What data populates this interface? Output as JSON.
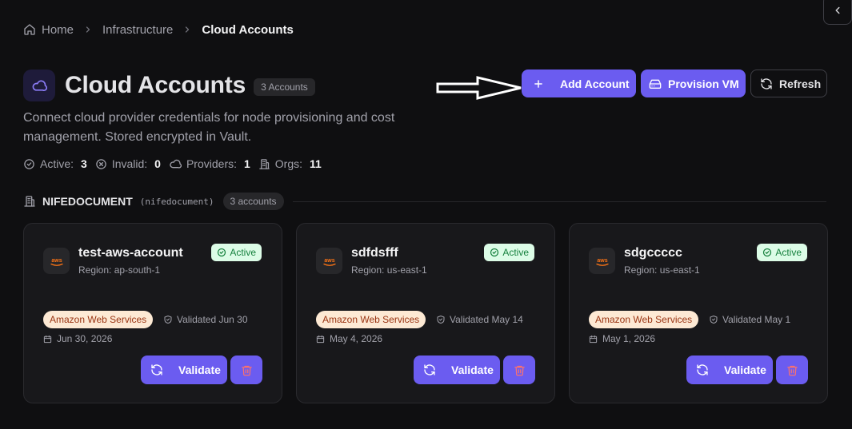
{
  "breadcrumb": {
    "items": [
      "Home",
      "Infrastructure",
      "Cloud Accounts"
    ]
  },
  "header": {
    "title": "Cloud Accounts",
    "count_label": "3 Accounts",
    "description": "Connect cloud provider credentials for node provisioning and cost management. Stored encrypted in Vault."
  },
  "actions": {
    "add_label": "Add Account",
    "provision_label": "Provision VM",
    "refresh_label": "Refresh"
  },
  "stats": {
    "active_label": "Active:",
    "active_value": "3",
    "invalid_label": "Invalid:",
    "invalid_value": "0",
    "providers_label": "Providers:",
    "providers_value": "1",
    "orgs_label": "Orgs:",
    "orgs_value": "11"
  },
  "org": {
    "name": "NIFEDOCUMENT",
    "slug": "(nifedocument)",
    "count_label": "3 accounts"
  },
  "accounts": [
    {
      "name": "test-aws-account",
      "region": "Region: ap-south-1",
      "status": "Active",
      "provider": "Amazon Web Services",
      "validated": "Validated Jun 30",
      "date": "Jun 30, 2026",
      "validate_label": "Validate"
    },
    {
      "name": "sdfdsfff",
      "region": "Region: us-east-1",
      "status": "Active",
      "provider": "Amazon Web Services",
      "validated": "Validated May 14",
      "date": "May 4, 2026",
      "validate_label": "Validate"
    },
    {
      "name": "sdgccccc",
      "region": "Region: us-east-1",
      "status": "Active",
      "provider": "Amazon Web Services",
      "validated": "Validated May 1",
      "date": "May 1, 2026",
      "validate_label": "Validate"
    }
  ],
  "colors": {
    "accent": "#6b5cf0",
    "background": "#0f0f11",
    "card": "#18181b",
    "status_active_bg": "#dcfce7",
    "status_active_fg": "#15803d",
    "provider_tag_bg": "#fde9d4",
    "provider_tag_fg": "#9a3412",
    "delete_icon": "#f87171",
    "aws_orange": "#f97316"
  }
}
